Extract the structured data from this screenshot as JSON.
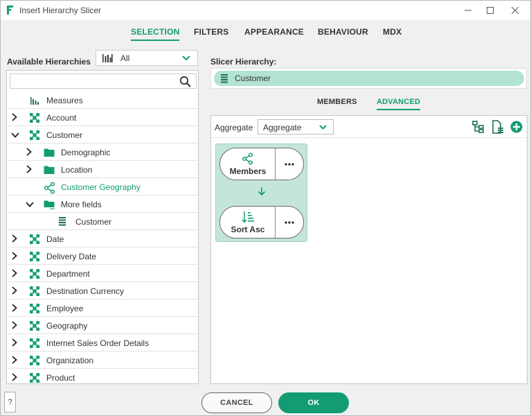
{
  "window": {
    "title": "Insert Hierarchy Slicer",
    "controls": [
      "minimize-icon",
      "maximize-icon",
      "close-icon"
    ]
  },
  "tabs": [
    {
      "label": "SELECTION",
      "active": true
    },
    {
      "label": "FILTERS",
      "active": false
    },
    {
      "label": "APPEARANCE",
      "active": false
    },
    {
      "label": "BEHAVIOUR",
      "active": false
    },
    {
      "label": "MDX",
      "active": false
    }
  ],
  "left": {
    "label": "Available Hierarchies",
    "dimension_select": {
      "value": "All",
      "icon": "bar-chart-icon"
    },
    "search": {
      "value": "",
      "placeholder": "",
      "icon": "search-icon"
    },
    "tree": [
      {
        "label": "Measures",
        "icon": "measures-icon",
        "expand": "none",
        "indent": 0
      },
      {
        "label": "Account",
        "icon": "dimension-icon",
        "expand": "collapsed",
        "indent": 0
      },
      {
        "label": "Customer",
        "icon": "dimension-icon",
        "expand": "expanded",
        "indent": 0
      },
      {
        "label": "Demographic",
        "icon": "folder-icon",
        "expand": "collapsed",
        "indent": 1
      },
      {
        "label": "Location",
        "icon": "folder-icon",
        "expand": "collapsed",
        "indent": 1
      },
      {
        "label": "Customer Geography",
        "icon": "hierarchy-icon",
        "expand": "none",
        "indent": 1,
        "selected": true
      },
      {
        "label": "More fields",
        "icon": "folder-more-icon",
        "expand": "expanded",
        "indent": 1
      },
      {
        "label": "Customer",
        "icon": "level-icon",
        "expand": "none",
        "indent": 2
      },
      {
        "label": "Date",
        "icon": "dimension-icon",
        "expand": "collapsed",
        "indent": 0
      },
      {
        "label": "Delivery Date",
        "icon": "dimension-icon",
        "expand": "collapsed",
        "indent": 0
      },
      {
        "label": "Department",
        "icon": "dimension-icon",
        "expand": "collapsed",
        "indent": 0
      },
      {
        "label": "Destination Currency",
        "icon": "dimension-icon",
        "expand": "collapsed",
        "indent": 0
      },
      {
        "label": "Employee",
        "icon": "dimension-icon",
        "expand": "collapsed",
        "indent": 0
      },
      {
        "label": "Geography",
        "icon": "dimension-icon",
        "expand": "collapsed",
        "indent": 0
      },
      {
        "label": "Internet Sales Order Details",
        "icon": "dimension-icon",
        "expand": "collapsed",
        "indent": 0
      },
      {
        "label": "Organization",
        "icon": "dimension-icon",
        "expand": "collapsed",
        "indent": 0
      },
      {
        "label": "Product",
        "icon": "dimension-icon",
        "expand": "collapsed",
        "indent": 0
      }
    ]
  },
  "right": {
    "label": "Slicer Hierarchy:",
    "slicer_item": {
      "label": "Customer",
      "icon": "level-icon"
    },
    "subtabs": [
      {
        "label": "MEMBERS",
        "active": false
      },
      {
        "label": "ADVANCED",
        "active": true
      }
    ],
    "aggregate": {
      "label": "Aggregate",
      "value": "Aggregate"
    },
    "toolbar_icons": [
      "tree-structure-icon",
      "document-list-icon",
      "add-circle-icon"
    ],
    "flow": [
      {
        "label": "Members",
        "icon": "share-icon"
      },
      {
        "label": "Sort Asc",
        "icon": "sort-asc-icon"
      }
    ]
  },
  "footer": {
    "help": "?",
    "cancel": "CANCEL",
    "ok": "OK"
  },
  "colors": {
    "accent": "#139c74",
    "pill": "#b3e3d3",
    "flow_bg": "#c4e6d9"
  }
}
